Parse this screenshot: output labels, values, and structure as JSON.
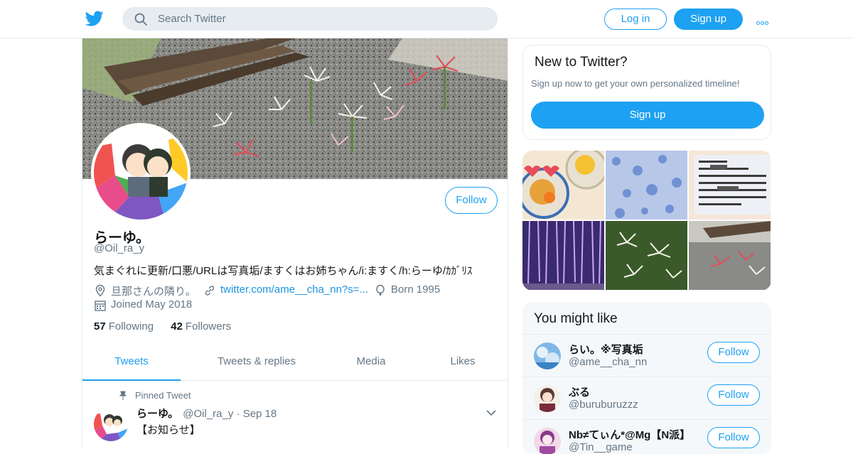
{
  "header": {
    "search_placeholder": "Search Twitter",
    "login_label": "Log in",
    "signup_label": "Sign up"
  },
  "profile": {
    "follow_label": "Follow",
    "name": "らーゆ。",
    "handle": "@Oil_ra_y",
    "bio": "気まぐれに更新/口悪/URLは写真垢/ますくはお姉ちゃん/i:ますく/h:らーゆ/ｶｶﾞﾘｽ",
    "location": "旦那さんの隣り。",
    "url": "twitter.com/ame__cha_nn?s=...",
    "birth": "Born 1995",
    "joined": "Joined May 2018",
    "following_count": "57",
    "following_label": "Following",
    "followers_count": "42",
    "followers_label": "Followers"
  },
  "tabs": [
    {
      "label": "Tweets",
      "active": true
    },
    {
      "label": "Tweets & replies",
      "active": false
    },
    {
      "label": "Media",
      "active": false
    },
    {
      "label": "Likes",
      "active": false
    }
  ],
  "pinned_tweet": {
    "pinned_label": "Pinned Tweet",
    "name": "らーゆ。",
    "handle": "@Oil_ra_y",
    "separator": "·",
    "date": "Sep 18",
    "text": "【お知らせ】"
  },
  "sidebar": {
    "new_title": "New to Twitter?",
    "new_text": "Sign up now to get your own personalized timeline!",
    "new_button": "Sign up",
    "wtf_title": "You might like",
    "suggestions": [
      {
        "name": "らい。※写真垢",
        "handle": "@ame__cha_nn",
        "button": "Follow"
      },
      {
        "name": "ぶる",
        "handle": "@buruburuzzz",
        "button": "Follow"
      },
      {
        "name": "Nb≠てぃん*@Mg【N派】",
        "handle": "@Tin__game",
        "button": "Follow"
      }
    ]
  },
  "colors": {
    "accent": "#1da1f2",
    "muted": "#657786",
    "text": "#14171a",
    "border": "#e6ecf0"
  }
}
